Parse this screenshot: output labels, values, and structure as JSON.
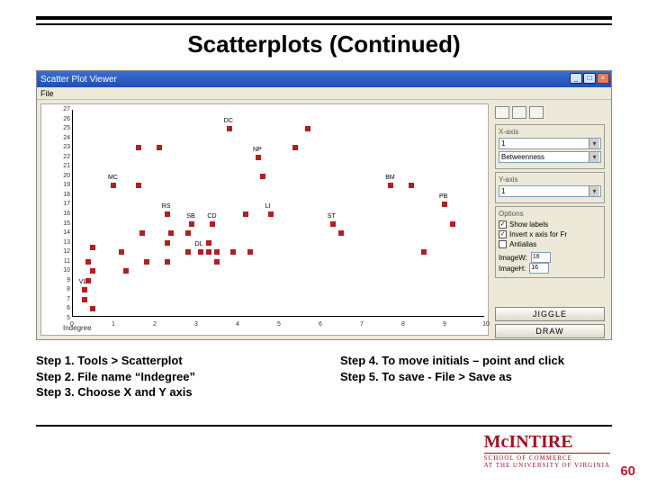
{
  "slide": {
    "title": "Scatterplots (Continued)",
    "page_number": "60"
  },
  "steps_left": {
    "s1": "Step 1. Tools > Scatterplot",
    "s2": "Step 2. File name “Indegree”",
    "s3": "Step 3. Choose X and Y axis"
  },
  "steps_right": {
    "s4": "Step 4. To move initials – point and click",
    "s5": "Step 5. To save - File > Save as"
  },
  "window": {
    "title": "Scatter Plot Viewer",
    "menu_file": "File",
    "btn_min": "_",
    "btn_max": "□",
    "btn_close": "×"
  },
  "sidepanel": {
    "xaxis_label": "X-axis",
    "xaxis_line1": "1",
    "xaxis_line2": "Betweenness",
    "yaxis_label": "Y-axis",
    "yaxis_line1": "1",
    "options_label": "Options",
    "opt1": "Show labels",
    "opt2": "Invert x axis for Fr",
    "opt3": "Antialias",
    "imgw_label": "ImageW:",
    "imgh_label": "ImageH:",
    "imgw": "16",
    "imgh": "16",
    "btn_jiggle": "JIGGLE",
    "btn_draw": "DRAW"
  },
  "chart_data": {
    "type": "scatter",
    "title": "",
    "xlabel": "Indegree",
    "ylabel": "",
    "xlim": [
      0,
      10
    ],
    "ylim": [
      5,
      27
    ],
    "xticks": [
      0,
      1,
      2,
      3,
      4,
      5,
      6,
      7,
      8,
      9,
      10
    ],
    "yticks": [
      5,
      6,
      7,
      8,
      9,
      10,
      11,
      12,
      13,
      14,
      15,
      16,
      17,
      18,
      19,
      20,
      21,
      22,
      23,
      24,
      25,
      26,
      27
    ],
    "series": [
      {
        "name": "points",
        "values": [
          {
            "x": 0.3,
            "y": 8,
            "label": "VL"
          },
          {
            "x": 0.3,
            "y": 7,
            "label": ""
          },
          {
            "x": 0.4,
            "y": 11,
            "label": ""
          },
          {
            "x": 0.4,
            "y": 9,
            "label": ""
          },
          {
            "x": 0.5,
            "y": 6,
            "label": ""
          },
          {
            "x": 0.5,
            "y": 12.5,
            "label": ""
          },
          {
            "x": 0.5,
            "y": 10,
            "label": ""
          },
          {
            "x": 1.0,
            "y": 19,
            "label": "MC"
          },
          {
            "x": 1.2,
            "y": 12,
            "label": ""
          },
          {
            "x": 1.3,
            "y": 10,
            "label": ""
          },
          {
            "x": 1.6,
            "y": 23,
            "label": ""
          },
          {
            "x": 1.6,
            "y": 19,
            "label": ""
          },
          {
            "x": 1.7,
            "y": 14,
            "label": ""
          },
          {
            "x": 1.8,
            "y": 11,
            "label": ""
          },
          {
            "x": 2.1,
            "y": 23,
            "label": ""
          },
          {
            "x": 2.3,
            "y": 16,
            "label": "RS"
          },
          {
            "x": 2.3,
            "y": 13,
            "label": ""
          },
          {
            "x": 2.3,
            "y": 11,
            "label": ""
          },
          {
            "x": 2.4,
            "y": 14,
            "label": ""
          },
          {
            "x": 2.8,
            "y": 14,
            "label": ""
          },
          {
            "x": 2.8,
            "y": 12,
            "label": ""
          },
          {
            "x": 2.9,
            "y": 15,
            "label": "SB"
          },
          {
            "x": 3.1,
            "y": 12,
            "label": "DL"
          },
          {
            "x": 3.3,
            "y": 12,
            "label": ""
          },
          {
            "x": 3.3,
            "y": 13,
            "label": ""
          },
          {
            "x": 3.4,
            "y": 15,
            "label": "CD"
          },
          {
            "x": 3.5,
            "y": 11,
            "label": ""
          },
          {
            "x": 3.5,
            "y": 12,
            "label": ""
          },
          {
            "x": 3.8,
            "y": 25,
            "label": "DC"
          },
          {
            "x": 3.9,
            "y": 12,
            "label": ""
          },
          {
            "x": 4.2,
            "y": 16,
            "label": ""
          },
          {
            "x": 4.3,
            "y": 12,
            "label": ""
          },
          {
            "x": 4.5,
            "y": 22,
            "label": "NP"
          },
          {
            "x": 4.6,
            "y": 20,
            "label": ""
          },
          {
            "x": 4.8,
            "y": 16,
            "label": "LI"
          },
          {
            "x": 5.4,
            "y": 23,
            "label": ""
          },
          {
            "x": 5.7,
            "y": 25,
            "label": ""
          },
          {
            "x": 6.3,
            "y": 15,
            "label": "ST"
          },
          {
            "x": 6.5,
            "y": 14,
            "label": ""
          },
          {
            "x": 7.7,
            "y": 19,
            "label": "BM"
          },
          {
            "x": 8.2,
            "y": 19,
            "label": ""
          },
          {
            "x": 8.5,
            "y": 12,
            "label": ""
          },
          {
            "x": 9.0,
            "y": 17,
            "label": "PB"
          },
          {
            "x": 9.2,
            "y": 15,
            "label": ""
          }
        ]
      }
    ]
  },
  "logo": {
    "name": "McINTIRE",
    "sub1": "SCHOOL OF COMMERCE",
    "sub2": "AT THE UNIVERSITY OF VIRGINIA"
  }
}
